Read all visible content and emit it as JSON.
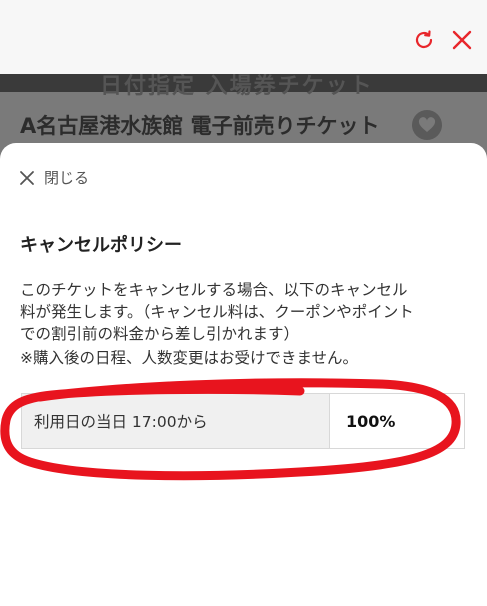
{
  "background": {
    "banner_text": "日付指定 入場券チケット",
    "title": "A名古屋港水族館 電子前売りチケット"
  },
  "topbar": {
    "refresh_icon": "refresh-icon",
    "close_icon": "close-icon",
    "accent_color": "#e8262b"
  },
  "sheet": {
    "close_label": "閉じる",
    "section_title": "キャンセルポリシー",
    "description_lines": [
      "このチケットをキャンセルする場合、以下のキャンセル",
      "料が発生します。（キャンセル料は、クーポンやポイント",
      "での割引前の料金から差し引かれます）"
    ],
    "note": "※購入後の日程、人数変更はお受けできません。",
    "policy_table": [
      {
        "condition": "利用日の当日 17:00から",
        "fee": "100%"
      }
    ]
  },
  "annotation": {
    "color": "#e8141e"
  }
}
